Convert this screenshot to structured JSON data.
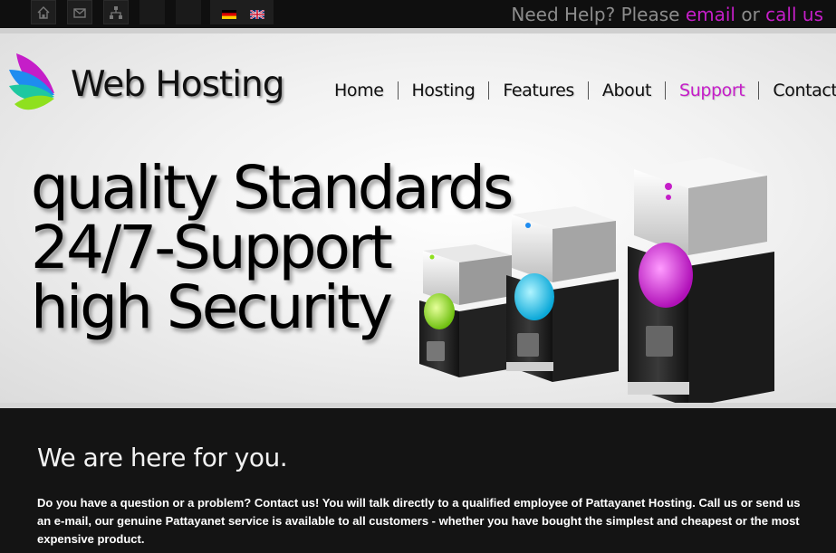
{
  "topbar": {
    "icons": [
      "home-icon",
      "mail-icon",
      "sitemap-icon"
    ],
    "languages": [
      "German",
      "English"
    ],
    "help": {
      "prefix": "Need Help? Please ",
      "email_label": "email",
      "or": " or ",
      "call_label": "call us"
    }
  },
  "brand": {
    "name": "Web Hosting"
  },
  "nav": {
    "items": [
      "Home",
      "Hosting",
      "Features",
      "About",
      "Support",
      "Contacts"
    ],
    "active": "Support"
  },
  "hero": {
    "lines": [
      "quality Standards",
      "24/7-Support",
      "high Security"
    ],
    "server_glow_colors": [
      "#8fe01e",
      "#1ec8f0",
      "#c51ec8"
    ]
  },
  "section": {
    "heading": "We are here for you.",
    "body": "Do you have a question or a problem? Contact us! You will talk directly to a qualified employee of Pattayanet Hosting. Call us or send us an e-mail, our genuine Pattayanet service is available to all customers - whether you have bought the simplest and cheapest or the most expensive product."
  },
  "colors": {
    "accent": "#c51ec8",
    "dark": "#141414"
  }
}
